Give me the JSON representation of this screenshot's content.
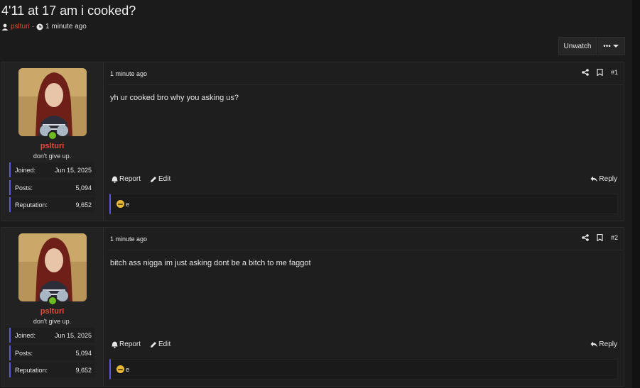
{
  "thread": {
    "title": "4'11 at 17 am i cooked?",
    "author": "pslturi",
    "separator": "·",
    "time": "1 minute ago",
    "buttons": {
      "unwatch": "Unwatch",
      "more": "•••"
    }
  },
  "icons": [
    "user-icon",
    "clock-icon",
    "share-icon",
    "bookmark-icon",
    "bell-icon",
    "pencil-icon",
    "reply-icon",
    "chevron-down-icon",
    "emoji-icon"
  ],
  "posts": [
    {
      "user": {
        "name": "pslturi",
        "title": "don't give up."
      },
      "stats": {
        "joined_label": "Joined:",
        "joined": "Jun 15, 2025",
        "posts_label": "Posts:",
        "posts": "5,094",
        "rep_label": "Reputation:",
        "rep": "9,652"
      },
      "date": "1 minute ago",
      "number": "#1",
      "body": "yh ur cooked bro why you asking us?",
      "actions": {
        "report": "Report",
        "edit": "Edit",
        "reply": "Reply"
      },
      "reaction": "e"
    },
    {
      "user": {
        "name": "pslturi",
        "title": "don't give up."
      },
      "stats": {
        "joined_label": "Joined:",
        "joined": "Jun 15, 2025",
        "posts_label": "Posts:",
        "posts": "5,094",
        "rep_label": "Reputation:",
        "rep": "9,652"
      },
      "date": "1 minute ago",
      "number": "#2",
      "body": "bitch ass nigga im just asking dont be a bitch to me faggot",
      "actions": {
        "report": "Report",
        "edit": "Edit",
        "reply": "Reply"
      },
      "reaction": "e"
    }
  ],
  "colors": {
    "accent": "#e24a3b",
    "online": "#6dbd22",
    "stat_border": "#5b5bd6"
  }
}
